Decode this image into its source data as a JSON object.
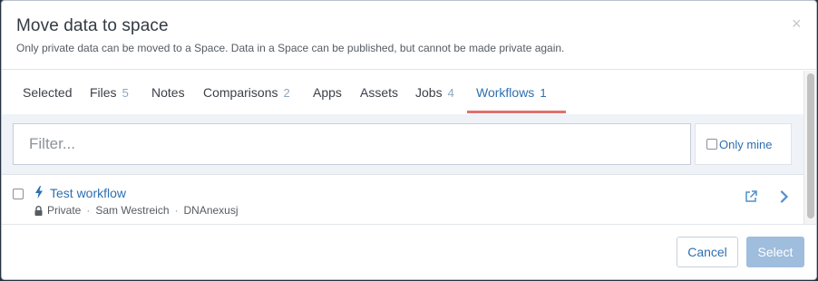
{
  "modal": {
    "title": "Move data to space",
    "subtitle": "Only private data can be moved to a Space. Data in a Space can be published, but cannot be made private again.",
    "close_symbol": "×"
  },
  "tabs": [
    {
      "label": "Selected",
      "count": ""
    },
    {
      "label": "Files",
      "count": "5"
    },
    {
      "label": "Notes",
      "count": ""
    },
    {
      "label": "Comparisons",
      "count": "2"
    },
    {
      "label": "Apps",
      "count": ""
    },
    {
      "label": "Assets",
      "count": ""
    },
    {
      "label": "Jobs",
      "count": "4"
    },
    {
      "label": "Workflows",
      "count": "1",
      "active": true
    }
  ],
  "filter": {
    "placeholder": "Filter...",
    "value": "",
    "only_mine_label": "Only mine"
  },
  "rows": [
    {
      "title": "Test workflow",
      "visibility": "Private",
      "owner": "Sam Westreich",
      "org": "DNAnexusj",
      "icon": "bolt-icon"
    }
  ],
  "footer": {
    "cancel_label": "Cancel",
    "select_label": "Select"
  },
  "colors": {
    "link_blue": "#2d6fb1",
    "active_tab_underline": "#e0716b",
    "select_disabled": "#9fbddc"
  }
}
